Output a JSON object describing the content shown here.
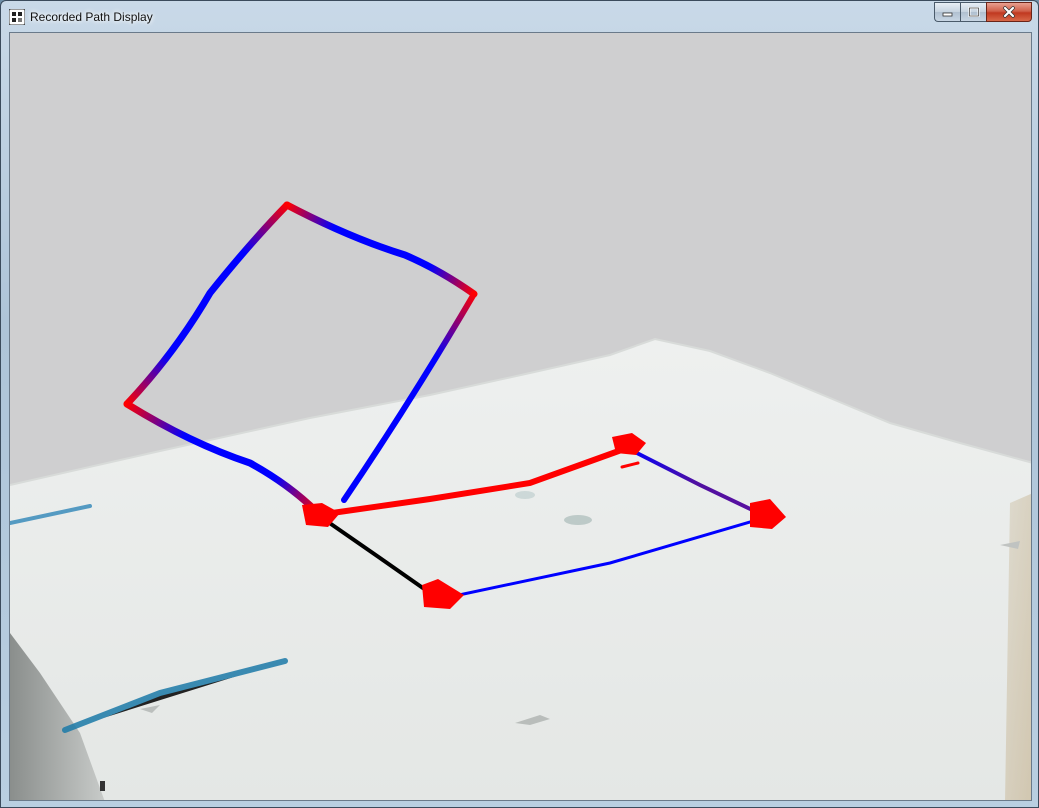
{
  "window": {
    "title": "Recorded Path Display"
  },
  "icons": {
    "app": "app-icon",
    "minimize": "minimize-icon",
    "maximize": "maximize-icon",
    "close": "close-icon"
  },
  "colors": {
    "path_start": "#ff0000",
    "path_end": "#0000ff",
    "waypoint": "#ff0000",
    "connector": "#000000",
    "ground": "#e9ecea",
    "sky": "#cfcfd0"
  }
}
